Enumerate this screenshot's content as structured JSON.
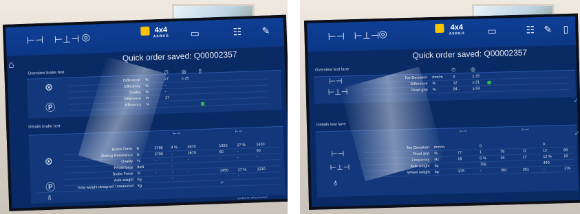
{
  "colors": {
    "screen_bg": "#0a2a66",
    "topbar": "#0e3f95",
    "accent_green": "#2fbf4a",
    "logo_yellow": "#f5c400"
  },
  "icons": [
    "vehicle-axle-icon",
    "tyre-icon",
    "scale-icon",
    "printer-icon",
    "list-icon",
    "edit-icon",
    "home-icon"
  ],
  "logo": {
    "main": "4x4",
    "sub": "ASRKO"
  },
  "left": {
    "saved": "Quick order saved: Q00002357",
    "overview_title": "Overview brake test",
    "overview_rows": [
      {
        "label": "Difference",
        "unit": "%",
        "v1": "27",
        "v2": "≤ 25",
        "v3": ""
      },
      {
        "label": "Efficiency",
        "unit": "%",
        "v1": "-",
        "v2": "",
        "v3": ""
      },
      {
        "label": "Ovality",
        "unit": "%",
        "v1": "-",
        "v2": "",
        "v3": ""
      },
      {
        "label": "Difference",
        "unit": "%",
        "v1": "17",
        "v2": "",
        "v3": ""
      },
      {
        "label": "Efficiency",
        "unit": "%",
        "v1": "-",
        "v2": "",
        "v3": ""
      }
    ],
    "details_title": "Details brake test",
    "details_rows": [
      {
        "label": "Brake Force",
        "unit": "N",
        "c": [
          "2790",
          "4 %",
          "2670",
          "1920",
          "27 %",
          "1410"
        ]
      },
      {
        "label": "Rolling Resistance",
        "unit": "N",
        "c": [
          "2790",
          "-",
          "2670",
          "60",
          "-",
          "60"
        ]
      },
      {
        "label": "Ovality",
        "unit": "%",
        "c": [
          "-",
          "-",
          "-",
          "-",
          "-",
          "-"
        ]
      },
      {
        "label": "Pedal force",
        "unit": "daN",
        "c": [
          "",
          "-",
          "",
          "",
          "",
          ""
        ]
      },
      {
        "label": "Brake Force",
        "unit": "N",
        "c": [
          "-",
          "-",
          "-",
          "1450",
          "17 %",
          "1210"
        ]
      },
      {
        "label": "Axle weight",
        "unit": "kg",
        "c": [
          "",
          "-",
          "",
          "",
          "-",
          ""
        ]
      },
      {
        "label": "Total weight designed / measured",
        "unit": "kg",
        "c": [
          "",
          "",
          "",
          "-/-",
          "",
          ""
        ]
      }
    ],
    "footer": "symbol for Wheel locked"
  },
  "right": {
    "saved": "Quick order saved: Q00002357",
    "overview_title": "Overview test lane",
    "overview_rows": [
      {
        "label": "Toe Deviation",
        "unit": "mm/m",
        "v1": "0",
        "v2": "≤ ±5"
      },
      {
        "label": "Difference",
        "unit": "%",
        "v1": "12",
        "v2": "≤ 21"
      },
      {
        "label": "Road grip",
        "unit": "%",
        "v1": "84",
        "v2": "≥ 59"
      }
    ],
    "details_title": "Details test lane",
    "details_rows": [
      {
        "label": "Toe Deviation",
        "unit": "mm/m",
        "c": [
          "",
          "0",
          "",
          "",
          "0",
          ""
        ]
      },
      {
        "label": "Road grip",
        "unit": "%",
        "c": [
          "77",
          "1",
          "78",
          "72",
          "12",
          "84"
        ]
      },
      {
        "label": "Frequency",
        "unit": "Hz",
        "c": [
          "16",
          "0 %",
          "16",
          "17",
          "12 %",
          "15"
        ]
      },
      {
        "label": "Axle weight",
        "unit": "kg",
        "c": [
          "",
          "756",
          "",
          "",
          "440",
          ""
        ]
      },
      {
        "label": "Wheel weight",
        "unit": "kg",
        "c": [
          "375",
          "-",
          "381",
          "261",
          "-",
          "179"
        ]
      }
    ]
  }
}
